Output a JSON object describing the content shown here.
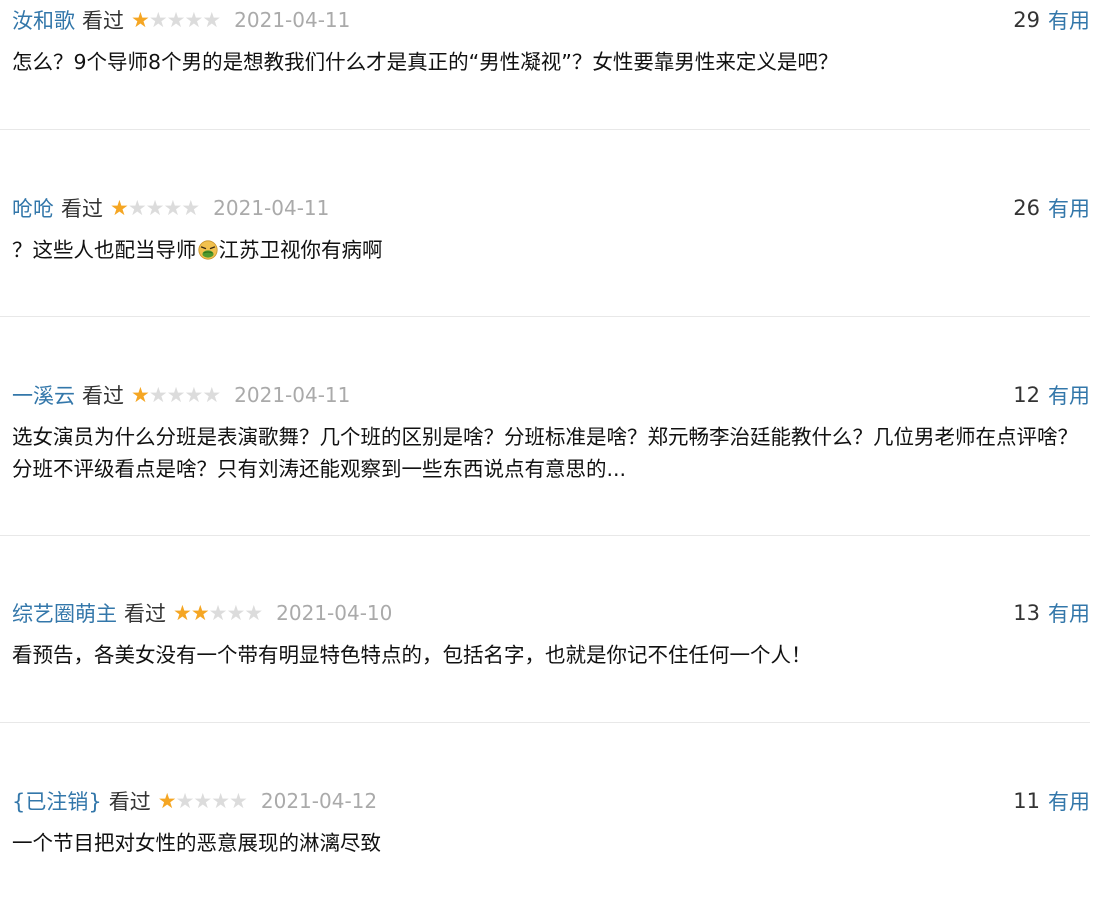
{
  "comments": [
    {
      "user": "汝和歌",
      "status": "看过",
      "rating": 1,
      "rating_max": 5,
      "date": "2021-04-11",
      "votes": "29",
      "useful_label": "有用",
      "text": "怎么？9个导师8个男的是想教我们什么才是真正的“男性凝视”？女性要靠男性来定义是吧？"
    },
    {
      "user": "呛呛",
      "status": "看过",
      "rating": 1,
      "rating_max": 5,
      "date": "2021-04-11",
      "votes": "26",
      "useful_label": "有用",
      "text_before_emoji": "？这些人也配当导师",
      "emoji": "nauseated-face-icon",
      "text_after_emoji": "江苏卫视你有病啊"
    },
    {
      "user": "一溪云",
      "status": "看过",
      "rating": 1,
      "rating_max": 5,
      "date": "2021-04-11",
      "votes": "12",
      "useful_label": "有用",
      "text": "选女演员为什么分班是表演歌舞？几个班的区别是啥？分班标准是啥？郑元畅李治廷能教什么？几位男老师在点评啥？分班不评级看点是啥？只有刘涛还能观察到一些东西说点有意思的..."
    },
    {
      "user": "综艺圈萌主",
      "status": "看过",
      "rating": 2,
      "rating_max": 5,
      "date": "2021-04-10",
      "votes": "13",
      "useful_label": "有用",
      "text": "看预告，各美女没有一个带有明显特色特点的，包括名字，也就是你记不住任何一个人！"
    },
    {
      "user": "{已注销}",
      "status": "看过",
      "rating": 1,
      "rating_max": 5,
      "date": "2021-04-12",
      "votes": "11",
      "useful_label": "有用",
      "text": "一个节目把对女性的恶意展现的淋漓尽致"
    }
  ],
  "colors": {
    "link": "#3377aa",
    "star_full": "#f5a623",
    "star_empty": "#dcdcdc",
    "date": "#aaaaaa",
    "divider": "#e8e8e8"
  }
}
